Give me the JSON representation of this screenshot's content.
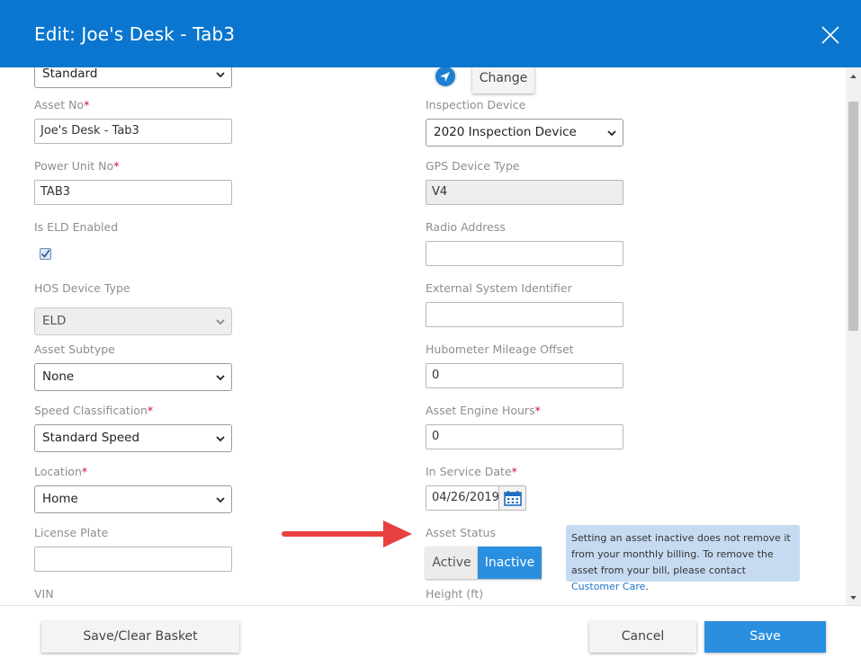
{
  "dialog": {
    "title": "Edit: Joe's Desk - Tab3"
  },
  "left": {
    "top_select": {
      "value": "Standard"
    },
    "asset_no": {
      "label": "Asset No",
      "required": "*",
      "value": "Joe's Desk - Tab3"
    },
    "power_unit_no": {
      "label": "Power Unit No",
      "required": "*",
      "value": "TAB3"
    },
    "is_eld_enabled": {
      "label": "Is ELD Enabled",
      "checked": true
    },
    "hos_device_type": {
      "label": "HOS Device Type",
      "value": "ELD"
    },
    "asset_subtype": {
      "label": "Asset Subtype",
      "value": "None"
    },
    "speed_classification": {
      "label": "Speed Classification",
      "required": "*",
      "value": "Standard Speed"
    },
    "location": {
      "label": "Location",
      "required": "*",
      "value": "Home"
    },
    "license_plate": {
      "label": "License Plate",
      "value": ""
    },
    "vin": {
      "label": "VIN"
    }
  },
  "right": {
    "change_button": {
      "label": "Change"
    },
    "inspection_device": {
      "label": "Inspection Device",
      "value": "2020 Inspection Device"
    },
    "gps_device_type": {
      "label": "GPS Device Type",
      "value": "V4"
    },
    "radio_address": {
      "label": "Radio Address",
      "value": ""
    },
    "external_system_identifier": {
      "label": "External System Identifier",
      "value": ""
    },
    "hubometer_mileage_offset": {
      "label": "Hubometer Mileage Offset",
      "value": "0"
    },
    "asset_engine_hours": {
      "label": "Asset Engine Hours",
      "required": "*",
      "value": "0"
    },
    "in_service_date": {
      "label": "In Service Date",
      "required": "*",
      "value": "04/26/2019"
    },
    "asset_status": {
      "label": "Asset Status",
      "options": [
        "Active",
        "Inactive"
      ],
      "selected": "Inactive"
    },
    "height": {
      "label": "Height (ft)"
    }
  },
  "info": {
    "text": "Setting an asset inactive does not remove it from your monthly billing. To remove the asset from your bill, please contact ",
    "link": "Customer Care",
    "suffix": "."
  },
  "footer": {
    "save_clear_basket": "Save/Clear Basket",
    "cancel": "Cancel",
    "save": "Save"
  },
  "colors": {
    "header": "#0a76cf",
    "primary": "#2b8fe0",
    "required": "#c8102e",
    "info_bg": "#c6dbf2",
    "annotation_arrow": "#e8403f"
  },
  "icons": [
    "close-icon",
    "location-arrow-icon",
    "calendar-icon",
    "chevron-down-icon",
    "checkmark-icon",
    "scroll-up-icon",
    "scroll-down-icon"
  ]
}
